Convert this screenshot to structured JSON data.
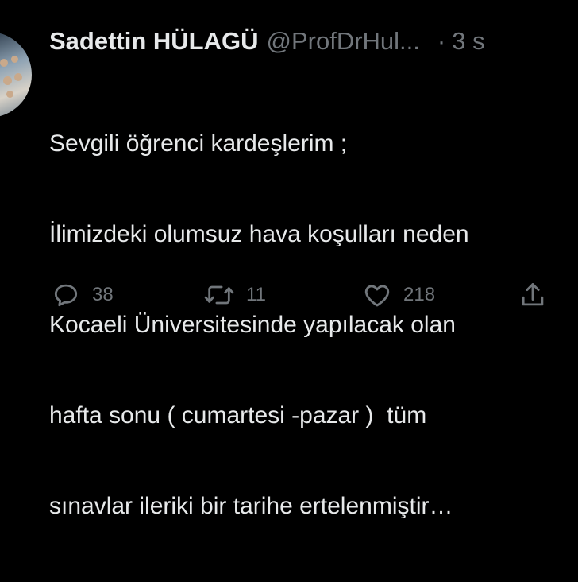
{
  "tweet": {
    "author_name": "Sadettin HÜLAGÜ",
    "handle": "@ProfDrHul...",
    "separator": "·",
    "time": "3 s",
    "lines": [
      "Sevgili öğrenci kardeşlerim ;",
      "İlimizdeki olumsuz hava koşulları neden",
      "Kocaeli Üniversitesinde yapılacak olan",
      "hafta sonu ( cumartesi -pazar )  tüm",
      "sınavlar ileriki bir tarihe ertelenmiştir…"
    ],
    "reply_count": "38",
    "retweet_count": "11",
    "like_count": "218"
  },
  "icons": {
    "reply": "reply-icon",
    "retweet": "retweet-icon",
    "like": "heart-icon",
    "share": "share-icon"
  },
  "colors": {
    "background": "#000000",
    "text": "#e7e9ea",
    "muted": "#71767b"
  }
}
